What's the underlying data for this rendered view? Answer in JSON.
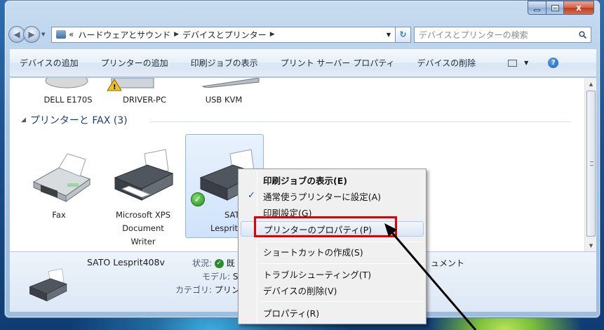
{
  "window": {
    "controls": {
      "minimize": "",
      "maximize": "",
      "close": "x"
    }
  },
  "address": {
    "prefix": "«",
    "crumbs": [
      "ハードウェアとサウンド",
      "デバイスとプリンター"
    ],
    "search_placeholder": "デバイスとプリンターの検索"
  },
  "toolbar": {
    "commands": [
      "デバイスの追加",
      "プリンターの追加",
      "印刷ジョブの表示",
      "プリント サーバー プロパティ",
      "デバイスの削除"
    ]
  },
  "devices_top": [
    "DELL E170S",
    "DRIVER-PC",
    "USB KVM"
  ],
  "printers_group": {
    "header": "プリンターと FAX (3)"
  },
  "printers": [
    {
      "lines": [
        "Fax"
      ]
    },
    {
      "lines": [
        "Microsoft XPS",
        "Document",
        "Writer"
      ]
    },
    {
      "lines": [
        "SATO",
        "Lesprit40"
      ]
    }
  ],
  "details": {
    "name": "SATO Lesprit408v",
    "status_label": "状況:",
    "status_value": "既",
    "model_label": "モデル:",
    "model_value": "SATO",
    "category_label": "カテゴリ:",
    "category_value": "プリン",
    "documents_fragment": "ュメント"
  },
  "context_menu": {
    "items": [
      {
        "label": "印刷ジョブの表示(E)",
        "bold": true
      },
      {
        "label": "通常使うプリンターに設定(A)",
        "checked": true
      },
      {
        "label": "印刷設定(G)"
      },
      {
        "label": "プリンターのプロパティ(P)",
        "hover": true
      },
      {
        "label": "ショートカットの作成(S)"
      },
      {
        "label": "トラブルシューティング(T)"
      },
      {
        "label": "デバイスの削除(V)"
      },
      {
        "label": "プロパティ(R)"
      }
    ],
    "check_glyph": "✓"
  },
  "colors": {
    "highlight_box": "#e00000",
    "annotation_arrow": "#000000",
    "selection_blue": "#cfe3fb"
  }
}
